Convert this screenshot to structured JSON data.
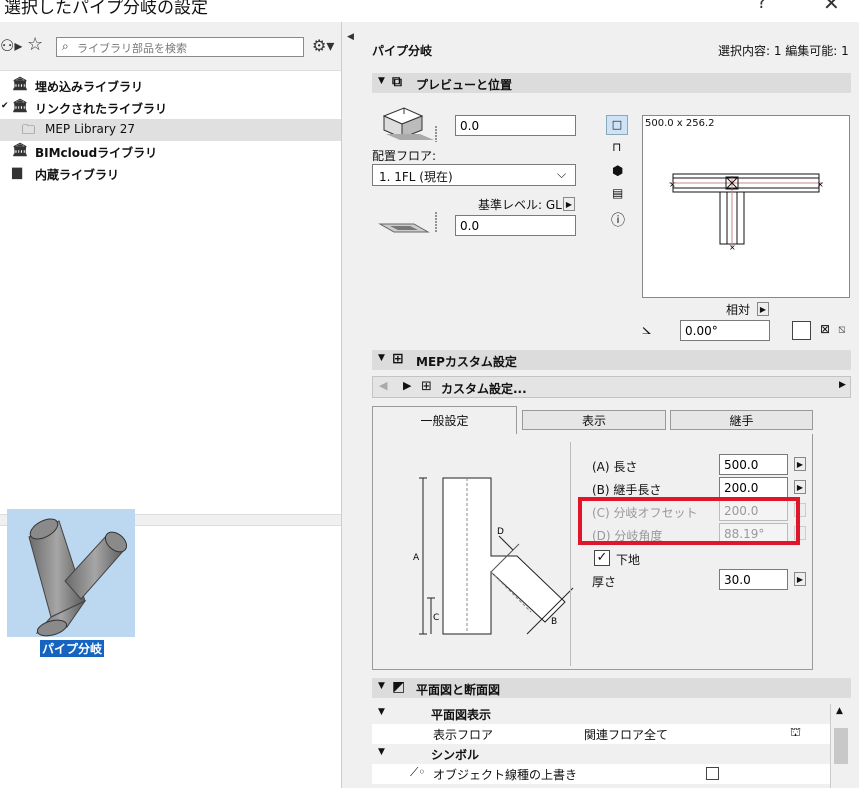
{
  "window": {
    "title": "選択したパイプ分岐の設定",
    "help": "?",
    "close": "✕"
  },
  "library": {
    "search_placeholder": "ライブラリ部品を検索",
    "tree": [
      {
        "label": "埋め込みライブラリ",
        "icon": "library-icon"
      },
      {
        "label": "リンクされたライブラリ",
        "icon": "linked-library-icon"
      },
      {
        "label": "MEP Library 27",
        "icon": "folder-icon"
      },
      {
        "label": "BIMcloudライブラリ",
        "icon": "bimcloud-icon"
      },
      {
        "label": "内蔵ライブラリ",
        "icon": "folder-icon"
      }
    ],
    "selected_item": "パイプ分岐"
  },
  "header": {
    "name": "パイプ分岐",
    "status": "選択内容: 1 編集可能: 1"
  },
  "preview": {
    "section_title": "プレビューと位置",
    "offset_top": "0.0",
    "floor_label": "配置フロア:",
    "floor_value": "1. 1FL (現在)",
    "ref_level_label": "基準レベル: GL",
    "offset_bottom": "0.0",
    "dim_label": "500.0 x 256.2",
    "relative_label": "相対",
    "angle_value": "0.00°"
  },
  "mep": {
    "section_title": "MEPカスタム設定",
    "custom_label": "カスタム設定...",
    "tabs": [
      "一般設定",
      "表示",
      "継手"
    ],
    "params": [
      {
        "label": "(A) 長さ",
        "value": "500.0",
        "enabled": true
      },
      {
        "label": "(B) 継手長さ",
        "value": "200.0",
        "enabled": true
      },
      {
        "label": "(C) 分岐オフセット",
        "value": "200.0",
        "enabled": false
      },
      {
        "label": "(D) 分岐角度",
        "value": "88.19°",
        "enabled": false
      }
    ],
    "base_label": "下地",
    "thickness_label": "厚さ",
    "thickness_value": "30.0",
    "diagram_labels": {
      "a": "A",
      "b": "B",
      "c": "C",
      "d": "D"
    }
  },
  "plan": {
    "section_title": "平面図と断面図",
    "rows": [
      {
        "name": "平面図表示",
        "value": "",
        "group": true
      },
      {
        "name": "表示フロア",
        "value": "関連フロア全て",
        "group": false
      },
      {
        "name": "シンボル",
        "value": "",
        "group": true
      },
      {
        "name": "オブジェクト線種の上書き",
        "value": "",
        "group": false
      }
    ]
  },
  "colors": {
    "highlight": "#e0152a",
    "selection": "#1565c0",
    "thumb_bg": "#bcd8f0"
  }
}
